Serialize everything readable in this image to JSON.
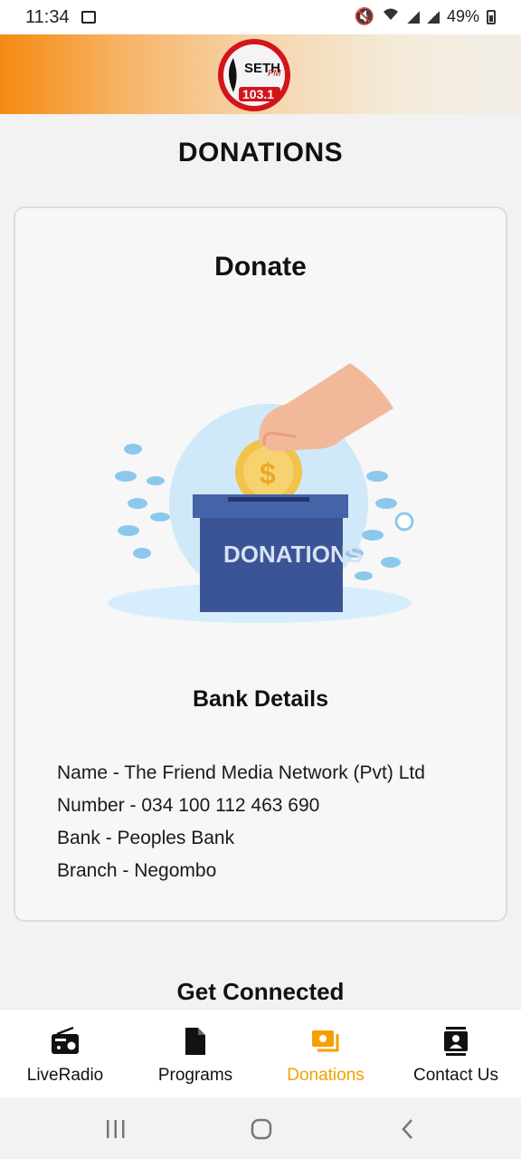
{
  "status_bar": {
    "time": "11:34",
    "battery": "49%"
  },
  "header": {
    "logo_alt": "SETH FM 103.1",
    "logo_text_top": "SETH",
    "logo_text_fm": "FM",
    "logo_text_freq": "103.1"
  },
  "page": {
    "title": "DONATIONS"
  },
  "card": {
    "title": "Donate",
    "illustration_label": "DONATIONS",
    "bank_title": "Bank Details",
    "bank_lines": [
      "Name - The Friend Media Network (Pvt) Ltd",
      "Number - 034 100 112 463 690",
      "Bank - Peoples Bank",
      "Branch - Negombo"
    ]
  },
  "section": {
    "get_connected": "Get Connected"
  },
  "bottom_nav": {
    "items": [
      {
        "label": "LiveRadio",
        "icon": "radio-icon",
        "active": false
      },
      {
        "label": "Programs",
        "icon": "document-icon",
        "active": false
      },
      {
        "label": "Donations",
        "icon": "donations-icon",
        "active": true
      },
      {
        "label": "Contact Us",
        "icon": "contacts-icon",
        "active": false
      }
    ]
  },
  "colors": {
    "accent": "#f5a000",
    "header_orange": "#f58a12",
    "box_blue": "#3a5496"
  }
}
